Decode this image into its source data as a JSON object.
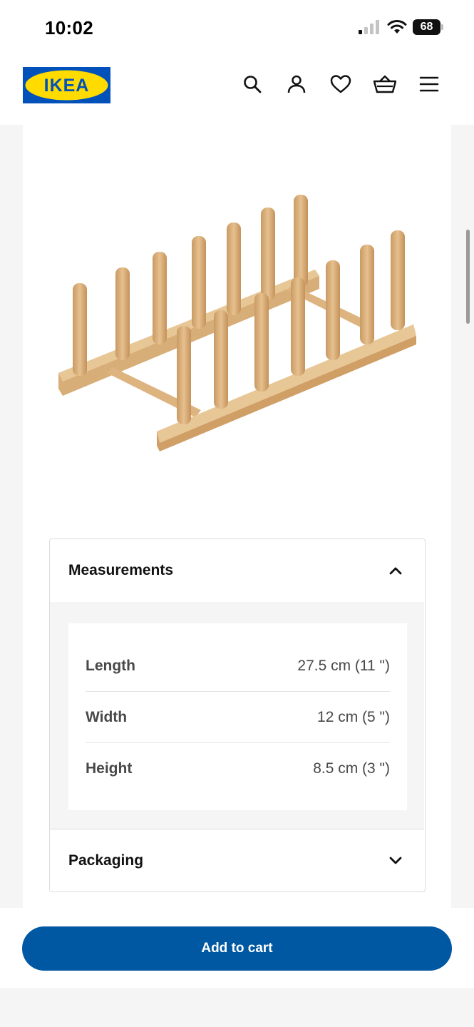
{
  "status_bar": {
    "time": "10:02",
    "battery": "68"
  },
  "header": {
    "logo_text": "IKEA",
    "icons": [
      "search-icon",
      "account-icon",
      "heart-icon",
      "cart-icon",
      "menu-icon"
    ]
  },
  "colors": {
    "brand_blue": "#0058a3",
    "brand_yellow": "#ffdb00",
    "logo_blue": "#0051ba"
  },
  "accordion": {
    "measurements_title": "Measurements",
    "rows": [
      {
        "label": "Length",
        "value": "27.5 cm (11 \")"
      },
      {
        "label": "Width",
        "value": "12 cm (5 \")"
      },
      {
        "label": "Height",
        "value": "8.5 cm (3 \")"
      }
    ],
    "packaging_title": "Packaging"
  },
  "cart": {
    "button_label": "Add to cart"
  }
}
